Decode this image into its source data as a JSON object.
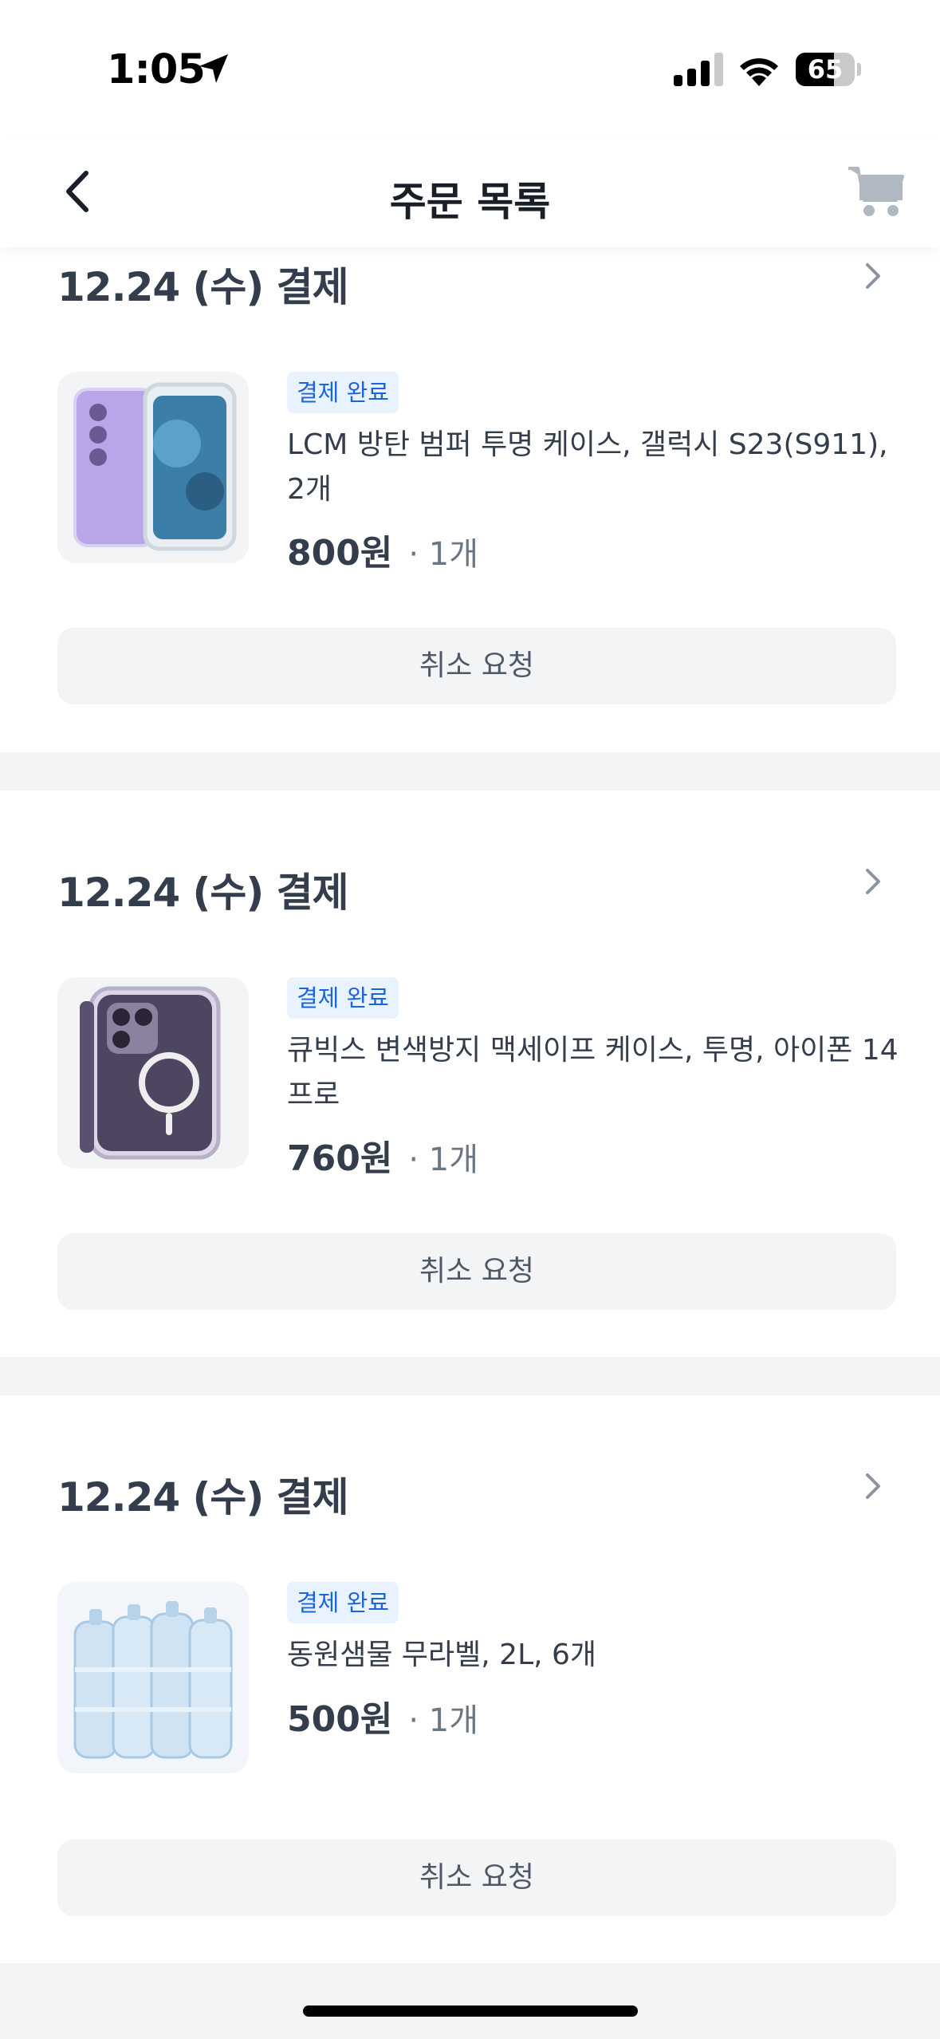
{
  "status_bar": {
    "time": "1:05",
    "battery_percent": 65
  },
  "nav": {
    "title": "주문 목록"
  },
  "orders": [
    {
      "date": "12.24 (수) 결제",
      "badge": "결제 완료",
      "product_name": "LCM 방탄 범퍼 투명 케이스, 갤럭시 S23(S911), 2개",
      "price": "800원",
      "quantity": "· 1개",
      "cancel_label": "취소 요청"
    },
    {
      "date": "12.24 (수) 결제",
      "badge": "결제 완료",
      "product_name": "큐빅스 변색방지 맥세이프 케이스, 투명, 아이폰 14 프로",
      "price": "760원",
      "quantity": "· 1개",
      "cancel_label": "취소 요청"
    },
    {
      "date": "12.24 (수) 결제",
      "badge": "결제 완료",
      "product_name": "동원샘물 무라벨, 2L, 6개",
      "price": "500원",
      "quantity": "· 1개",
      "cancel_label": "취소 요청"
    }
  ],
  "colors": {
    "badge_text": "#1b64da",
    "badge_bg": "#e8f3ff",
    "divider": "#f2f4f6",
    "text_primary": "#333d4b"
  }
}
